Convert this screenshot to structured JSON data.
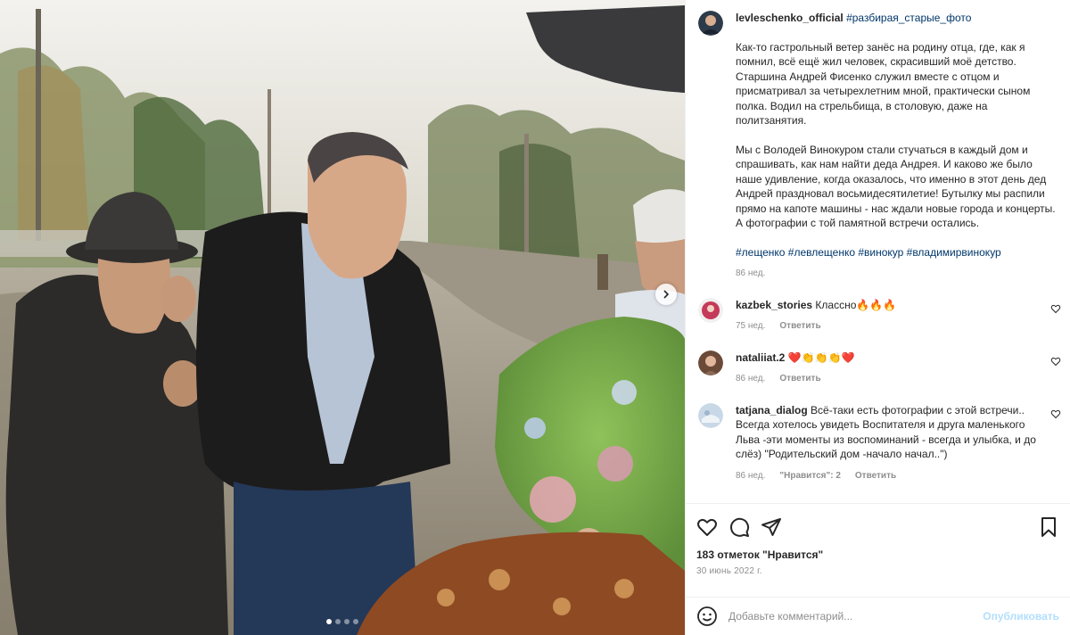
{
  "post": {
    "author": "levleschenko_official",
    "header_tag": "#разбирая_старые_фото",
    "caption": [
      "Как-то гастрольный ветер занёс на родину отца, где, как я помнил, всё ещё жил человек, скрасивший моё детство. Старшина Андрей Фисенко служил вместе с отцом и присматривал за четырехлетним мной, практически сыном полка. Водил на стрельбища, в столовую, даже на политзанятия.",
      "Мы с Володей Винокуром стали стучаться в каждый дом и спрашивать, как нам найти деда Андрея. И каково же было наше удивление, когда оказалось, что именно в этот день дед Андрей праздновал восьмидесятилетие! Бутылку мы распили прямо на капоте машины - нас ждали новые города и концерты. А фотографии с той памятной встречи остались."
    ],
    "hashtags": "#лещенко #левлещенко #винокур #владимирвинокур",
    "caption_age": "86 нед."
  },
  "comments": [
    {
      "user": "kazbek_stories",
      "text": "Классно🔥🔥🔥",
      "age": "75 нед.",
      "likes": "",
      "reply": "Ответить"
    },
    {
      "user": "nataliiat.2",
      "text": "❤️👏👏👏❤️",
      "age": "86 нед.",
      "likes": "",
      "reply": "Ответить"
    },
    {
      "user": "tatjana_dialog",
      "text": "Всё-таки есть фотографии с этой встречи.. Всегда хотелось увидеть Воспитателя и друга маленького Льва -эти моменты из воспоминаний - всегда и улыбка, и до слёз) \"Родительский дом -начало начал..\")",
      "age": "86 нед.",
      "likes": "\"Нравится\": 2",
      "reply": "Ответить"
    }
  ],
  "actions": {
    "likes": "183 отметок \"Нравится\"",
    "date": "30 июнь 2022 г."
  },
  "composer": {
    "placeholder": "Добавьте комментарий...",
    "publish": "Опубликовать"
  },
  "colors": {
    "link": "#00376b",
    "muted": "#8e8e8e",
    "publish_disabled": "#b2dffc",
    "heart_red": "#ed4956"
  },
  "icons": [
    "heart-icon",
    "comment-icon",
    "share-icon",
    "bookmark-icon",
    "emoji-icon",
    "next-arrow-icon"
  ]
}
